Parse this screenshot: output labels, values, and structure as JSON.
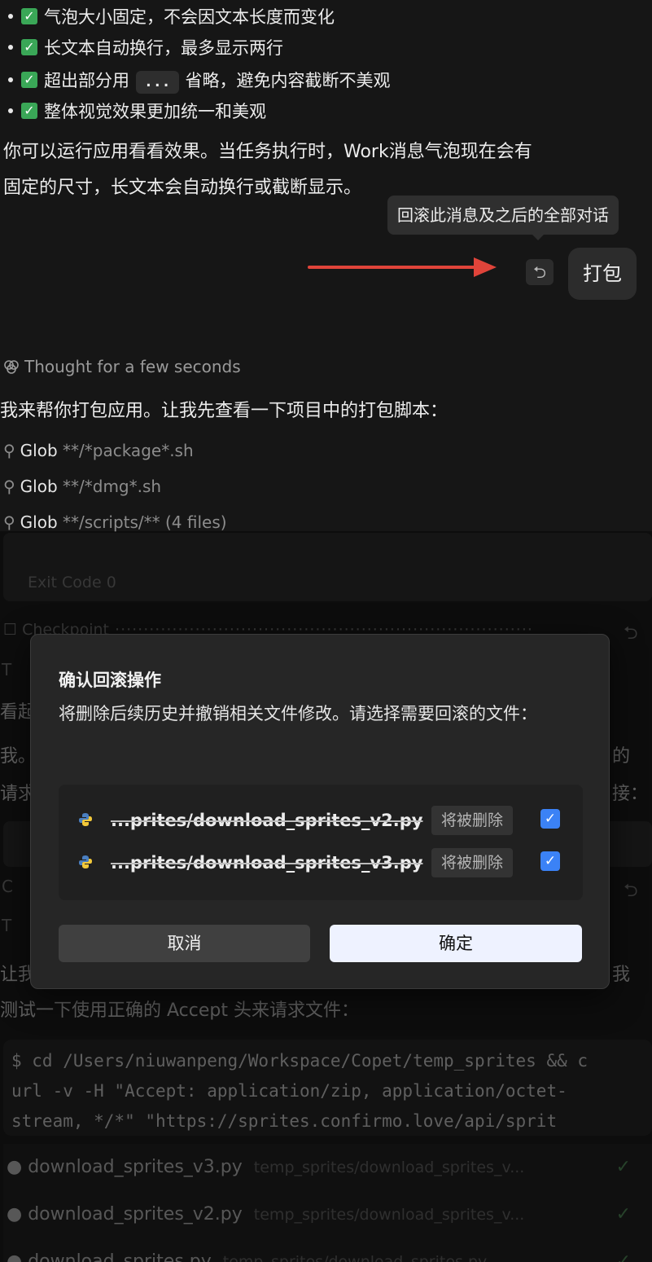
{
  "chat": {
    "bullets": [
      {
        "check": "✓",
        "text": "气泡大小固定，不会因文本长度而变化"
      },
      {
        "check": "✓",
        "text": "长文本自动换行，最多显示两行"
      },
      {
        "check": "✓",
        "text_before": "超出部分用",
        "code": "...",
        "text_after": "省略，避免内容截断不美观"
      },
      {
        "check": "✓",
        "text": "整体视觉效果更加统一和美观"
      }
    ],
    "summary_line1": "你可以运行应用看看效果。当任务执行时，Work消息气泡现在会有",
    "summary_line2": "固定的尺寸，长文本会自动换行或截断显示。",
    "tooltip": "回滚此消息及之后的全部对话",
    "undo_glyph": "⮌",
    "user_message": "打包",
    "thought_icon": "brain-icon",
    "thought_text": "Thought for a few seconds",
    "reply": "我来帮你打包应用。让我先查看一下项目中的打包脚本：",
    "globs": [
      {
        "tool": "Glob",
        "pattern": "**/*package*.sh"
      },
      {
        "tool": "Glob",
        "pattern": "**/*dmg*.sh"
      },
      {
        "tool": "Glob",
        "pattern": "**/scripts/** (4 files)"
      }
    ],
    "exit_code": "Exit Code 0",
    "checkpoint_label": "Checkpoint",
    "bg_fragments": {
      "left1": "看起",
      "left2": "我。",
      "right2": "的",
      "left3": "请求",
      "right3": "接：",
      "left4": "让我",
      "right4": "我",
      "t_label": "T",
      "c_label": "C"
    },
    "test_line": "测试一下使用正确的 Accept 头来请求文件：",
    "terminal": {
      "line1": "$ cd /Users/niuwanpeng/Workspace/Copet/temp_sprites && c",
      "line2": "url -v -H \"Accept: application/zip, application/octet-",
      "line3": "stream, */*\" \"https://sprites.confirmo.love/api/sprit"
    },
    "files": [
      {
        "name": "download_sprites_v3.py",
        "path": "temp_sprites/download_sprites_v...",
        "status": "✓"
      },
      {
        "name": "download_sprites_v2.py",
        "path": "temp_sprites/download_sprites_v...",
        "status": "✓"
      },
      {
        "name": "download_sprites.py",
        "path": "temp_sprites/download_sprites.py",
        "status": "✓"
      }
    ]
  },
  "modal": {
    "title": "确认回滚操作",
    "description": "将删除后续历史并撤销相关文件修改。请选择需要回滚的文件：",
    "files": [
      {
        "name": "...prites/download_sprites_v2.py",
        "badge": "将被删除",
        "checked": "✓"
      },
      {
        "name": "...prites/download_sprites_v3.py",
        "badge": "将被删除",
        "checked": "✓"
      }
    ],
    "cancel_label": "取消",
    "confirm_label": "确定"
  },
  "colors": {
    "background": "#161616",
    "accent_arrow": "#e0443a",
    "checkbox": "#3b82f6",
    "check_emoji": "#3aa757",
    "confirm_button": "#eef2ff"
  }
}
